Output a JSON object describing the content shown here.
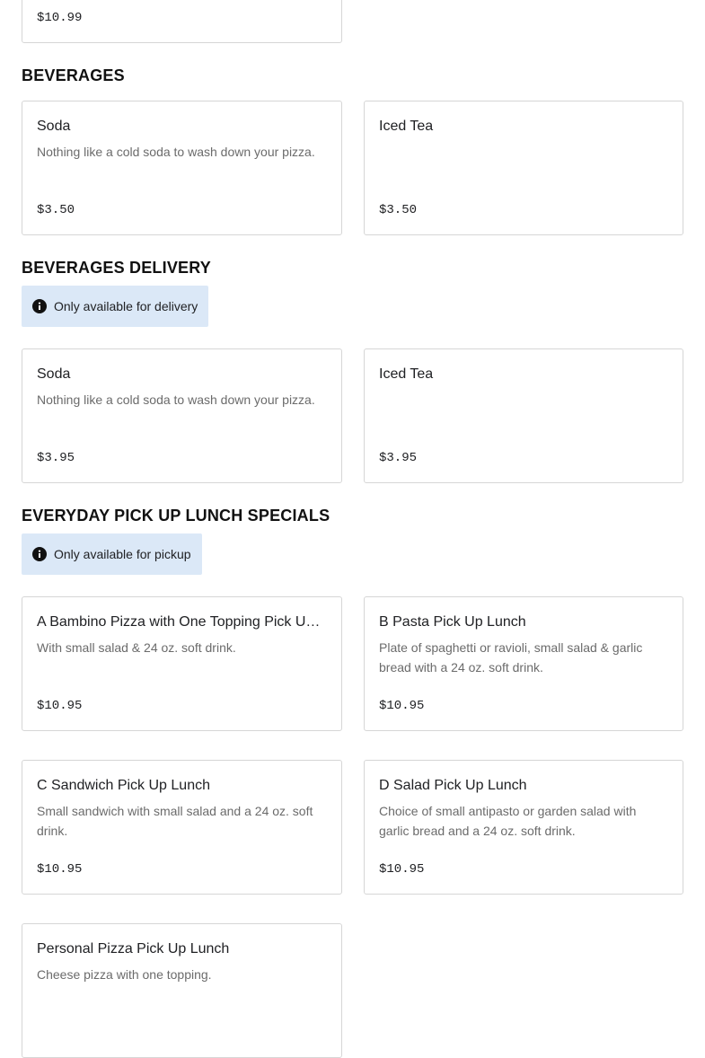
{
  "top_card": {
    "price": "$10.99"
  },
  "sections": {
    "beverages": {
      "title": "BEVERAGES",
      "items": [
        {
          "name": "Soda",
          "description": "Nothing like a cold soda to wash down your pizza.",
          "price": "$3.50"
        },
        {
          "name": "Iced Tea",
          "description": "",
          "price": "$3.50"
        }
      ]
    },
    "beverages_delivery": {
      "title": "BEVERAGES DELIVERY",
      "notice": "Only available for delivery",
      "items": [
        {
          "name": "Soda",
          "description": "Nothing like a cold soda to wash down your pizza.",
          "price": "$3.95"
        },
        {
          "name": "Iced Tea",
          "description": "",
          "price": "$3.95"
        }
      ]
    },
    "lunch_specials": {
      "title": "EVERYDAY PICK UP LUNCH SPECIALS",
      "notice": "Only available for pickup",
      "items": [
        {
          "name": "A Bambino Pizza with One Topping Pick Up Lunch",
          "description": "With small salad & 24 oz. soft drink.",
          "price": "$10.95"
        },
        {
          "name": "B Pasta Pick Up Lunch",
          "description": "Plate of spaghetti or ravioli, small salad & garlic bread with a 24 oz. soft drink.",
          "price": "$10.95"
        },
        {
          "name": "C Sandwich Pick Up Lunch",
          "description": "Small sandwich with small salad and a 24 oz. soft drink.",
          "price": "$10.95"
        },
        {
          "name": "D Salad Pick Up Lunch",
          "description": "Choice of small antipasto or garden salad with garlic bread and a 24 oz. soft drink.",
          "price": "$10.95"
        },
        {
          "name": "Personal Pizza Pick Up Lunch",
          "description": "Cheese pizza with one topping.",
          "price": ""
        }
      ]
    }
  },
  "icons": {
    "notice_icon": "info-circle-icon"
  },
  "colors": {
    "notice_bg": "#dbe8f7",
    "card_border": "#d6d6d6",
    "description_text": "#6b6b6b"
  }
}
